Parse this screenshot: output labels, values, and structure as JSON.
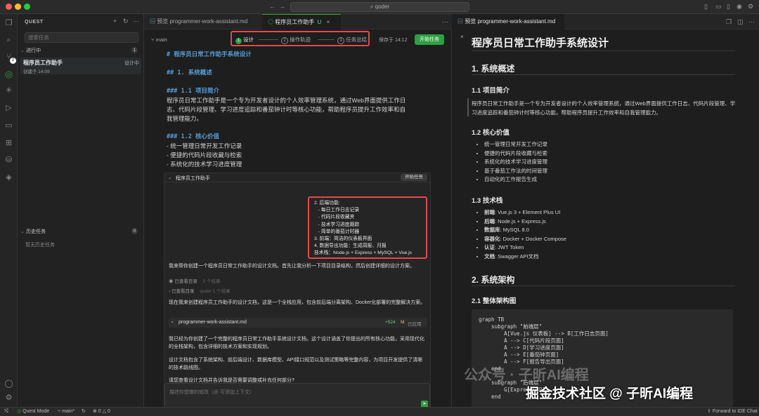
{
  "window": {
    "title": "qoder"
  },
  "activity_icons": [
    "files-icon",
    "search-icon",
    "source-control-icon",
    "quest-icon",
    "extensions-icon",
    "run-debug-icon",
    "terminal-icon",
    "grid-icon",
    "database-icon",
    "cube-icon"
  ],
  "sidebar": {
    "title": "QUEST",
    "search_placeholder": "搜索任务",
    "in_progress_label": "进行中",
    "in_progress_count": "1",
    "task": {
      "name": "程序员工作助手",
      "status": "设计中",
      "created": "创建于 14:09"
    },
    "history_label": "历史任务",
    "history_count": "0",
    "history_empty": "暂无历史任务"
  },
  "mid": {
    "tabs": [
      {
        "label": "预览 programmer-work-assistant.md"
      },
      {
        "label": "程序员工作助手",
        "badge": "U"
      }
    ],
    "branch": "main",
    "steps": [
      {
        "num": "1",
        "label": "设计"
      },
      {
        "num": "2",
        "label": "操作轨迹"
      },
      {
        "num": "3",
        "label": "任务总结"
      }
    ],
    "saved": "保存于 14:12",
    "start_button": "开始任务",
    "editor_lines": [
      {
        "text": "# 程序员日常工作助手系统设计",
        "kind": "h"
      },
      {
        "text": "",
        "kind": "blank"
      },
      {
        "text": "## 1. 系统概述",
        "kind": "h"
      },
      {
        "text": "",
        "kind": "blank"
      },
      {
        "text": "### 1.1 项目简介",
        "kind": "h"
      },
      {
        "text": "程序员日常工作助手是一个专为开发者设计的个人效率管理系统，通过Web界面提供工作日",
        "kind": "p"
      },
      {
        "text": "志、代码片段管理、学习进度追踪和番茄钟计时等核心功能，帮助程序员提升工作效率和自",
        "kind": "p"
      },
      {
        "text": "我管理能力。",
        "kind": "p"
      },
      {
        "text": "",
        "kind": "blank"
      },
      {
        "text": "### 1.2 核心价值",
        "kind": "h"
      },
      {
        "text": "- 统一管理日常开发工作记录",
        "kind": "p"
      },
      {
        "text": "- 便捷的代码片段收藏与检索",
        "kind": "p"
      },
      {
        "text": "- 系统化的技术学习进度管理",
        "kind": "p"
      }
    ],
    "chat_header": "程序员工作助手",
    "chat_start": "开始任务",
    "red_lines": [
      "2. 后端功能:",
      "   - 每日工作日志记录",
      "   - 代码片段收藏夹",
      "   - 技术学习进度跟踪",
      "   - 简单的番茄计时器",
      "3. 前端：简洁的仪表板界面",
      "4. 数据导出功能：生成周报、月报",
      "技术栈：Node.js + Express + MySQL + Vue.js"
    ],
    "msg1": "我来帮你创建一个程序员日常工作助手的设计文档。首先让我分析一下项目目录结构，然后创建详细的设计方案。",
    "viewed_dir": "已查看目录",
    "viewed_dir_result": "0 个结果",
    "viewed_dir2": "已查看目录",
    "viewed_dir2_path": "qoder 1 个结果",
    "msg2": "现在我来创建程序员工作助手的设计文档，这是一个全栈应用，包含前后端分离架构、Docker化部署的完整解决方案。",
    "file_name": "programmer-work-assistant.md",
    "file_plus": "+524",
    "file_m": "M",
    "file_applied": "已应用",
    "msg3": "我已经为你创建了一个完整的程序员日常工作助手系统设计文档。这个设计涵盖了你提出的所有核心功能，采用现代化的全栈架构，包含详细的技术方案和实现规划。",
    "msg4": "设计文档包含了系统架构、前后端设计、数据库模型、API接口规范以及测试策略等完整内容，为项目开发提供了清晰的技术路线图。",
    "msg5": "请您查看设计文档并告诉我是否需要调整或补充任何部分?",
    "input_placeholder": "描述你想做的修改（@ 可添加上下文）"
  },
  "right": {
    "tab": "预览 programmer-work-assistant.md",
    "h1": "程序员日常工作助手系统设计",
    "s1": "1. 系统概述",
    "s11": "1.1 项目简介",
    "s11_text": "程序员日常工作助手是一个专为开发者设计的个人效率管理系统，通过Web界面提供工作日志、代码片段管理、学习进度追踪和番茄钟计时等核心功能，帮助程序员提升工作效率和自我管理能力。",
    "s12": "1.2 核心价值",
    "s12_items": [
      "统一管理日常开发工作记录",
      "便捷的代码片段收藏与检索",
      "系统化的技术学习进度管理",
      "基于番茄工作法的时间管理",
      "自动化的工作报告生成"
    ],
    "s13": "1.3 技术栈",
    "s13_items": [
      {
        "k": "前端",
        "v": "Vue.js 3 + Element Plus UI"
      },
      {
        "k": "后端",
        "v": "Node.js + Express.js"
      },
      {
        "k": "数据库",
        "v": "MySQL 8.0"
      },
      {
        "k": "容器化",
        "v": "Docker + Docker Compose"
      },
      {
        "k": "认证",
        "v": "JWT Token"
      },
      {
        "k": "文档",
        "v": "Swagger API文档"
      }
    ],
    "s2": "2. 系统架构",
    "s21": "2.1 整体架构图",
    "code_lines": [
      "graph TB",
      "    subgraph \"前端层\"",
      "        A[Vue.js 仪表板] --> B[工作日志页面]",
      "        A --> C[代码片段页面]",
      "        A --> D[学习进度页面]",
      "        A --> E[番茄钟页面]",
      "        A --> F[报告导出页面]",
      "    end",
      "",
      "    subgraph \"后端层\"",
      "        G[Express API]",
      "    end"
    ]
  },
  "watermark": "掘金技术社区 @ 子昕AI编程",
  "watermark_faint": "公众号 · 子昕AI编程",
  "statusbar": {
    "mode": "Quest Mode",
    "branch": "main*",
    "errors": "0",
    "warnings": "0",
    "forward": "Forward to IDE Chat"
  },
  "colors": {
    "accent_green": "#2ea043",
    "red_highlight": "#e5484d",
    "heading_blue": "#569cd6"
  }
}
